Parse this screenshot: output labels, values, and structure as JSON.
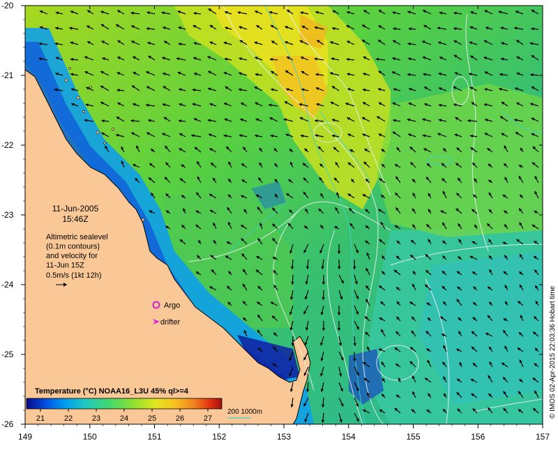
{
  "map": {
    "lon_ticks": [
      "149",
      "150",
      "151",
      "152",
      "153",
      "154",
      "155",
      "156",
      "157"
    ],
    "lat_ticks": [
      "-20",
      "-21",
      "-22",
      "-23",
      "-24",
      "-25",
      "-26"
    ],
    "extent": {
      "lon": [
        149,
        157
      ],
      "lat": [
        -26,
        -20
      ]
    }
  },
  "info_box": {
    "date": "11-Jun-2005",
    "time": "15:46Z",
    "description_lines": [
      "Altimetric sealevel",
      "(0.1m contours)",
      "and velocity for",
      "11-Jun 15Z"
    ],
    "scale_label": "0.5m/s (1kt 12h)"
  },
  "legend": {
    "argo_label": "Argo",
    "drifter_label": "drifter",
    "argo_color": "#cc22cc",
    "drifter_color": "#dd22dd"
  },
  "colorbar": {
    "title": "Temperature (°C) NOAA16_L3U 45% ql>=4",
    "ticks": [
      "21",
      "22",
      "23",
      "24",
      "25",
      "26",
      "27"
    ],
    "range": [
      20.5,
      27.5
    ],
    "colors": [
      "#0a0a8c",
      "#0050e0",
      "#00a0f0",
      "#20c8c0",
      "#40d870",
      "#90e030",
      "#e0e820",
      "#f8c020",
      "#f08020",
      "#e03010",
      "#a01010"
    ]
  },
  "depth_contours": {
    "label": "200  1000m",
    "color": "#40d0d0"
  },
  "credit": "© IMOS 02-Apr-2015 22:03:36 Hobart time",
  "colors": {
    "land": "#fac896",
    "coast": "#000000",
    "contour": "#e8f0f0"
  }
}
